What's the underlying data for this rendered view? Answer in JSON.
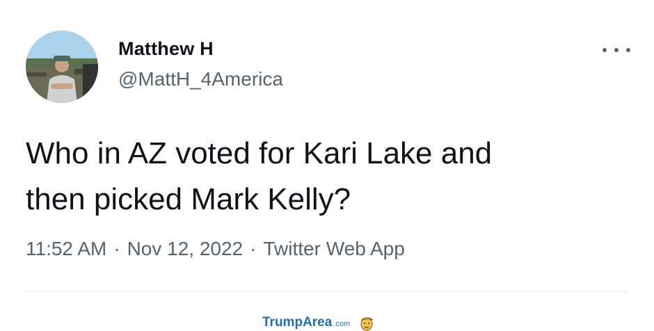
{
  "tweet": {
    "author_name": "Matthew H",
    "author_handle": "@MattH_4America",
    "text_line1": "Who in AZ voted for Kari Lake and",
    "text_line2": "then picked Mark Kelly?",
    "time": "11:52 AM",
    "date": "Nov 12, 2022",
    "source": "Twitter Web App",
    "separator": "·",
    "more_icon": "more-horizontal-icon"
  },
  "watermark": {
    "brand_part1": "Trump",
    "brand_part2": "Area",
    "brand_suffix": ".com",
    "mascot_icon": "trump-face-icon"
  },
  "colors": {
    "text_primary": "#0f1419",
    "text_secondary": "#536471",
    "divider": "#e6ecf0",
    "watermark": "#1d6fb8"
  }
}
